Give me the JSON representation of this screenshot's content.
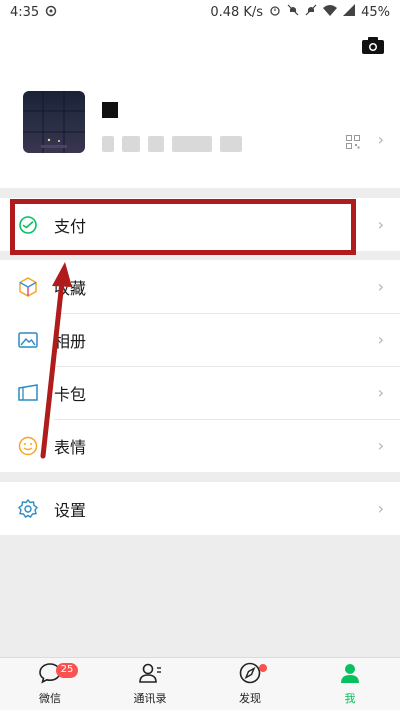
{
  "status_bar": {
    "time": "4:35",
    "network_speed": "0.48 K/s",
    "battery": "45%"
  },
  "profile": {
    "name": "",
    "wechat_id": ""
  },
  "menu_primary": [
    {
      "label": "支付",
      "icon": "pay-icon"
    }
  ],
  "menu_secondary": [
    {
      "label": "收藏",
      "icon": "favorites-icon"
    },
    {
      "label": "相册",
      "icon": "album-icon"
    },
    {
      "label": "卡包",
      "icon": "card-package-icon"
    },
    {
      "label": "表情",
      "icon": "sticker-icon"
    }
  ],
  "menu_settings": [
    {
      "label": "设置",
      "icon": "settings-icon"
    }
  ],
  "tabbar": {
    "tabs": [
      {
        "label": "微信",
        "icon": "chat-icon",
        "badge": "25"
      },
      {
        "label": "通讯录",
        "icon": "contacts-icon"
      },
      {
        "label": "发现",
        "icon": "discover-icon",
        "dot": true
      },
      {
        "label": "我",
        "icon": "me-icon",
        "active": true
      }
    ]
  },
  "colors": {
    "accent": "#07c160",
    "badge": "#fa5151",
    "highlight": "#b01c1c",
    "background": "#ededed"
  }
}
